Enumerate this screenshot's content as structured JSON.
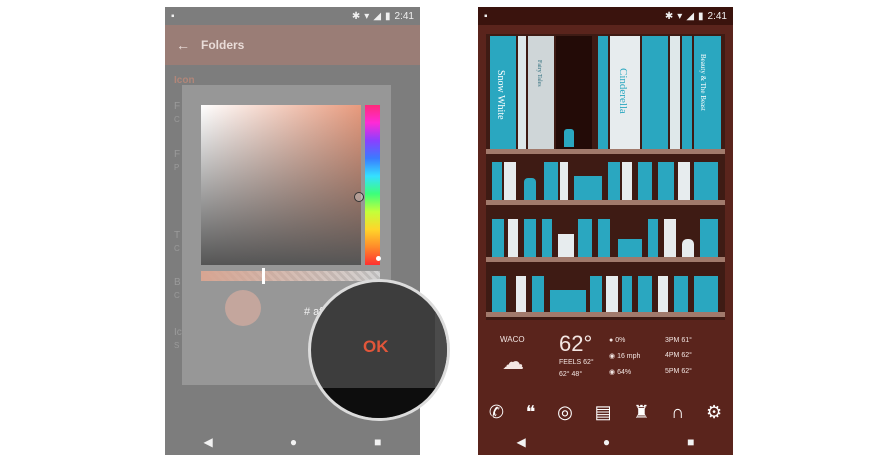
{
  "left_phone": {
    "status": {
      "time": "2:41"
    },
    "appbar": {
      "title": "Folders"
    },
    "list": {
      "section": "Icon",
      "rows": [
        "F",
        "C",
        "F",
        "P",
        "T",
        "C",
        "B",
        "C",
        "Ic",
        "S"
      ]
    },
    "color_picker": {
      "hex_text": "# af",
      "ok_label": "OK"
    }
  },
  "right_phone": {
    "status": {
      "time": "2:41"
    },
    "books": {
      "snow_white": "Snow White",
      "fairy_tales": "Fairy Tales",
      "cinderella": "Cinderella",
      "beauty": "Beauty & The Beast"
    },
    "weather": {
      "location": "WACO",
      "temperature": "62°",
      "feels_like": "FEELS 62°",
      "hi_lo": "62° 48°",
      "precip": "0%",
      "wind": "16 mph",
      "humidity": "64%",
      "forecast": [
        {
          "time": "3PM",
          "temp": "61°"
        },
        {
          "time": "4PM",
          "temp": "62°"
        },
        {
          "time": "5PM",
          "temp": "62°"
        }
      ]
    }
  },
  "icons": {
    "status": [
      "image-icon",
      "bluetooth-icon",
      "wifi-icon",
      "signal-icon",
      "battery-icon"
    ],
    "nav": [
      "back-icon",
      "home-icon",
      "recents-icon"
    ],
    "dock": [
      "phone-icon",
      "hangouts-icon",
      "chrome-icon",
      "books-icon",
      "android-icon",
      "headphones-icon",
      "settings-icon"
    ]
  },
  "colors": {
    "accent_ok": "#e2563a",
    "shelf_teal": "#2aa7c0",
    "wood": "#5a241c"
  }
}
